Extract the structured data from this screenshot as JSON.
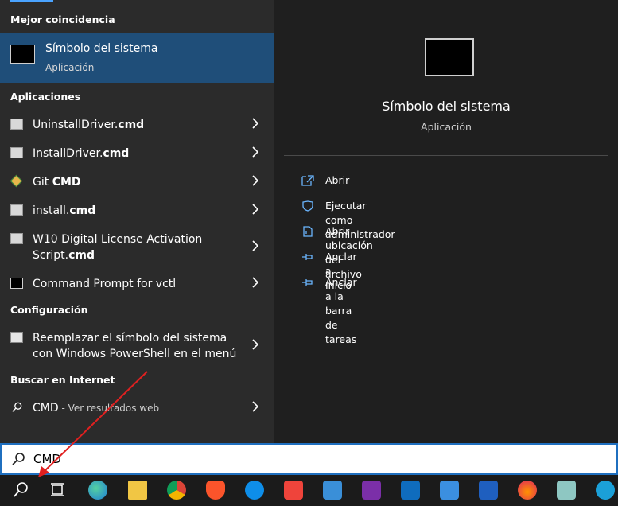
{
  "left": {
    "best_match_title": "Mejor coincidencia",
    "best_match": {
      "name": "Símbolo del sistema",
      "kind": "Aplicación",
      "icon": "cmd-icon"
    },
    "apps_title": "Aplicaciones",
    "apps": [
      {
        "pre": "UninstallDriver.",
        "bold": "cmd",
        "icon": "gear-file-icon"
      },
      {
        "pre": "InstallDriver.",
        "bold": "cmd",
        "icon": "gear-file-icon"
      },
      {
        "pre": "Git ",
        "bold": "CMD",
        "icon": "git-icon"
      },
      {
        "pre": "install.",
        "bold": "cmd",
        "icon": "gear-file-icon"
      },
      {
        "pre": "W10 Digital License Activation",
        "line2pre": "Script.",
        "bold": "cmd",
        "icon": "gear-file-icon"
      },
      {
        "pre": "Command Prompt for vctl",
        "bold": "",
        "icon": "cmd-icon"
      }
    ],
    "settings_title": "Configuración",
    "settings": [
      {
        "line1": "Reemplazar el símbolo del sistema",
        "line2": "con Windows PowerShell en el menú",
        "icon": "settings-doc-icon"
      }
    ],
    "web_title": "Buscar en Internet",
    "web": {
      "query": "CMD",
      "suffix": " - Ver resultados web",
      "icon": "search-icon"
    }
  },
  "right": {
    "title": "Símbolo del sistema",
    "kind": "Aplicación",
    "actions": [
      {
        "label": "Abrir",
        "icon": "open-icon"
      },
      {
        "label": "Ejecutar como administrador",
        "icon": "shield-icon"
      },
      {
        "label": "Abrir ubicación del archivo",
        "icon": "file-location-icon"
      },
      {
        "label": "Anclar a Inicio",
        "icon": "pin-icon"
      },
      {
        "label": "Anclar a la barra de tareas",
        "icon": "pin-icon"
      }
    ]
  },
  "search": {
    "value": "CMD"
  },
  "taskbar": {
    "icons": [
      "search-icon",
      "task-view-icon",
      "edge-icon",
      "file-explorer-icon",
      "chrome-icon",
      "brave-icon",
      "teamviewer-icon",
      "anydesk-icon",
      "remote-desktop-icon",
      "onenote-icon",
      "outlook-icon",
      "todo-icon",
      "word-icon",
      "firefox-icon",
      "notes-icon",
      "vpn-icon"
    ]
  },
  "colors": {
    "accent": "#1f4e79",
    "action_icon": "#6bb6ff",
    "focus_border": "#1f6fbf"
  }
}
